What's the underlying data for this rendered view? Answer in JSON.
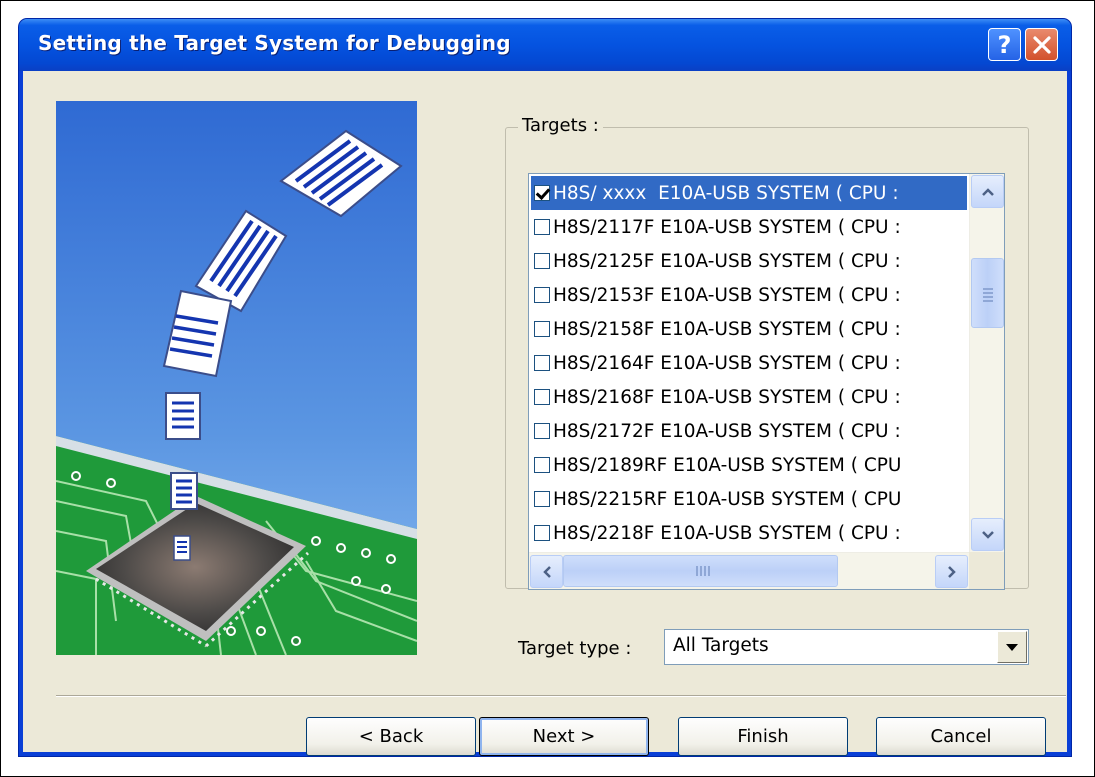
{
  "window": {
    "title": "Setting the Target System for Debugging",
    "help_glyph": "?",
    "close_glyph": "✕"
  },
  "targets": {
    "group_label": "Targets :",
    "items": [
      {
        "label": "H8S/ xxxx  E10A-USB SYSTEM ( CPU :",
        "checked": true,
        "selected": true
      },
      {
        "label": "H8S/2117F E10A-USB SYSTEM ( CPU :",
        "checked": false,
        "selected": false
      },
      {
        "label": "H8S/2125F E10A-USB SYSTEM ( CPU :",
        "checked": false,
        "selected": false
      },
      {
        "label": "H8S/2153F E10A-USB SYSTEM ( CPU :",
        "checked": false,
        "selected": false
      },
      {
        "label": "H8S/2158F E10A-USB SYSTEM ( CPU :",
        "checked": false,
        "selected": false
      },
      {
        "label": "H8S/2164F E10A-USB SYSTEM ( CPU :",
        "checked": false,
        "selected": false
      },
      {
        "label": "H8S/2168F E10A-USB SYSTEM ( CPU :",
        "checked": false,
        "selected": false
      },
      {
        "label": "H8S/2172F E10A-USB SYSTEM ( CPU :",
        "checked": false,
        "selected": false
      },
      {
        "label": "H8S/2189RF E10A-USB SYSTEM ( CPU",
        "checked": false,
        "selected": false
      },
      {
        "label": "H8S/2215RF E10A-USB SYSTEM ( CPU",
        "checked": false,
        "selected": false
      },
      {
        "label": "H8S/2218F E10A-USB SYSTEM ( CPU :",
        "checked": false,
        "selected": false
      }
    ]
  },
  "target_type": {
    "label": "Target type :",
    "value": "All Targets"
  },
  "buttons": {
    "back": "< Back",
    "next": "Next >",
    "finish": "Finish",
    "cancel": "Cancel"
  },
  "colors": {
    "titlebar": "#0553e0",
    "dialog_bg": "#ece9d8",
    "selection": "#316ac5",
    "sky": "#4a86d8",
    "board": "#1f9a3a"
  },
  "icons": {
    "help": "help-icon",
    "close": "close-icon",
    "scroll_up": "chevron-up-icon",
    "scroll_down": "chevron-down-icon",
    "scroll_left": "chevron-left-icon",
    "scroll_right": "chevron-right-icon",
    "dropdown": "dropdown-arrow-icon"
  }
}
